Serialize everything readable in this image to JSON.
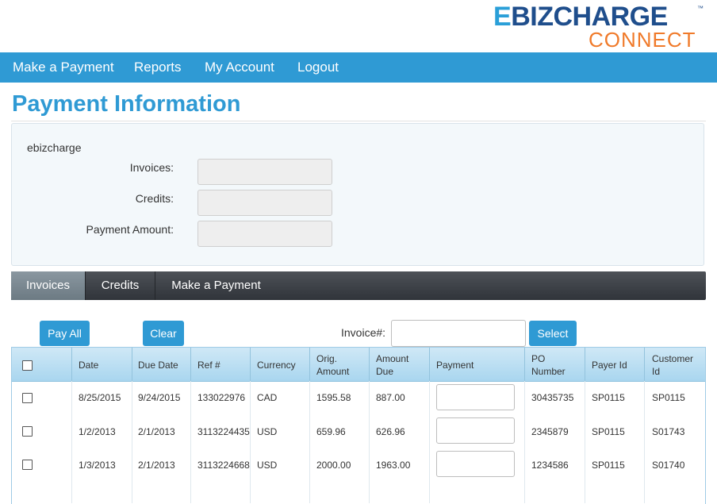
{
  "logo": {
    "brand_e": "E",
    "brand_main": "BIZCHARGE",
    "trademark": "™",
    "sub": "CONNECT"
  },
  "nav": {
    "items": [
      {
        "label": "Make a Payment"
      },
      {
        "label": "Reports"
      },
      {
        "label": "My Account"
      },
      {
        "label": "Logout"
      }
    ]
  },
  "page": {
    "title": "Payment Information"
  },
  "info": {
    "company": "ebizcharge",
    "invoices_label": "Invoices:",
    "invoices_value": "",
    "credits_label": "Credits:",
    "credits_value": "",
    "payment_amount_label": "Payment Amount:",
    "payment_amount_value": ""
  },
  "tabs": [
    {
      "label": "Invoices",
      "active": true
    },
    {
      "label": "Credits",
      "active": false
    },
    {
      "label": "Make a Payment",
      "active": false
    }
  ],
  "toolbar": {
    "pay_all": "Pay All",
    "clear": "Clear",
    "invoice_label": "Invoice#:",
    "invoice_value": "",
    "select": "Select"
  },
  "table": {
    "headers": {
      "date": "Date",
      "due_date": "Due Date",
      "ref": "Ref #",
      "currency": "Currency",
      "orig_amount_1": "Orig.",
      "orig_amount_2": "Amount",
      "amount_due_1": "Amount",
      "amount_due_2": "Due",
      "payment": "Payment",
      "po_1": "PO",
      "po_2": "Number",
      "payer": "Payer Id",
      "customer_1": "Customer",
      "customer_2": "Id"
    },
    "rows": [
      {
        "date": "8/25/2015",
        "due": "9/24/2015",
        "ref": "133022976",
        "currency": "CAD",
        "orig": "1595.58",
        "due_amt": "887.00",
        "payment": "",
        "po": "30435735",
        "payer": "SP0115",
        "customer": "SP0115"
      },
      {
        "date": "1/2/2013",
        "due": "2/1/2013",
        "ref": "3113224435",
        "currency": "USD",
        "orig": "659.96",
        "due_amt": "626.96",
        "payment": "",
        "po": "2345879",
        "payer": "SP0115",
        "customer": "S01743"
      },
      {
        "date": "1/3/2013",
        "due": "2/1/2013",
        "ref": "3113224668",
        "currency": "USD",
        "orig": "2000.00",
        "due_amt": "1963.00",
        "payment": "",
        "po": "1234586",
        "payer": "SP0115",
        "customer": "S01740"
      }
    ]
  },
  "colors": {
    "brand_blue": "#2f9ad4",
    "logo_navy": "#1f4e8c",
    "logo_orange": "#f07a2a",
    "tab_dark": "#3a3e44"
  }
}
